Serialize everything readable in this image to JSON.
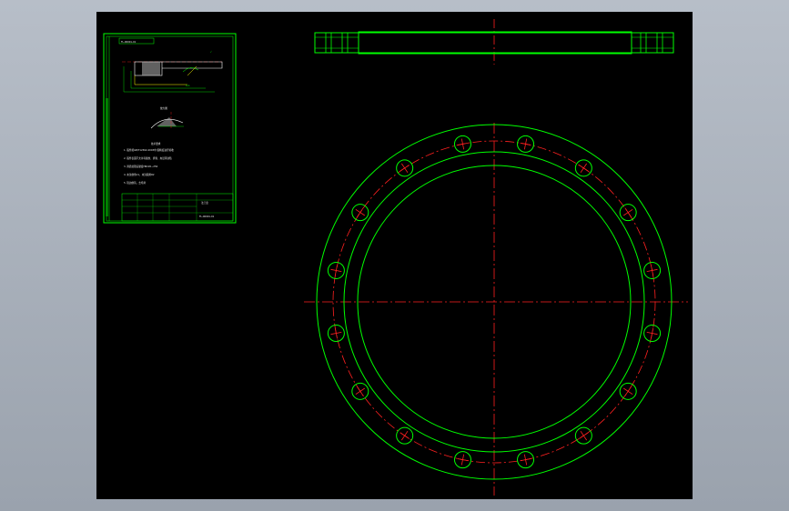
{
  "colors": {
    "background": "#000000",
    "outline": "#00ff00",
    "centerline": "#ff2020",
    "text": "#ffffff",
    "frame": "#b0b7c1"
  },
  "sheet": {
    "title_block_label": "技术要求",
    "requirement_lines": [
      "1. 锻件按GB/T12362-2003中 级精度进行验收",
      "2. 锻件表面不允许有裂纹、折叠、夹层等缺陷",
      "3. 调质处理后硬度HB220~250",
      "4. 未注倒角C1，未注圆角R2",
      "5. 锐边倒钝，去毛刺"
    ],
    "title_block_name": "法兰盘",
    "title_block_code": "FL-00001-01",
    "section_label": "A-A",
    "detail_label": "放大图"
  },
  "drawing": {
    "bolt_hole_count": 16,
    "views": [
      "top-view",
      "front-view"
    ]
  }
}
